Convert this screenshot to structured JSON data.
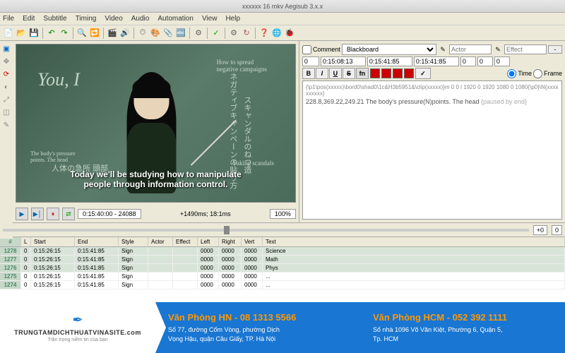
{
  "titlebar": "xxxxxx 16 mkv   Aegisub 3.x.x",
  "menu": {
    "file": "File",
    "edit": "Edit",
    "subtitle": "Subtitle",
    "timing": "Timing",
    "video": "Video",
    "audio": "Audio",
    "automation": "Automation",
    "view": "View",
    "help": "Help"
  },
  "video": {
    "chalk_you_i": "You, I",
    "chalk_spread": "How to spread\nnegative campaigns",
    "chalk_faking": "Faking scandals",
    "chalk_pressure": "The body's pressure\npoints. The head",
    "jp1": "ネガティブキャンペーンの貼り方",
    "jp2": "スキャンダルのねつ造",
    "jp3": "人体の急所  頭部",
    "subtitle_text": "Today we'll be studying how to manipulate\npeople through information control.",
    "time_display": "0:15:40:00 - 24088",
    "frame_info": "+1490ms; 18:1ms",
    "zoom": "100%"
  },
  "edit": {
    "comment_label": "Comment",
    "style_select": "Blackboard",
    "actor_ph": "Actor",
    "effect_ph": "Effect",
    "layer": "0",
    "start_time": "0:15:08:13",
    "end_time": "0:15:41:85",
    "duration": "0:15:41:85",
    "margin_l": "0",
    "margin_r": "0",
    "margin_v": "0",
    "radio_time": "Time",
    "radio_frame": "Frame",
    "tags": "{\\p1\\pos(xxxxx)\\bord0\\shad0\\1c&H3b5951&\\clip(xxxxx)}m 0 0 l 1920 0 1920 1080 0 1080{\\p0}\\N{xxxxxxxxxx}",
    "line_prefix": "228.8,369.22,249.21",
    "line_text": "The body's pressure(N)points. The head",
    "line_suffix": "{paused by end}"
  },
  "audio": {
    "pos": "+0",
    "dur": "0"
  },
  "grid": {
    "headers": {
      "num": "#",
      "L": "L",
      "start": "Start",
      "end": "End",
      "style": "Style",
      "actor": "Actor",
      "effect": "Effect",
      "left": "Left",
      "right": "Right",
      "vert": "Vert",
      "text": "Text"
    },
    "rows": [
      {
        "num": "1278",
        "L": "0",
        "start": "0:15:26:15",
        "end": "0:15:41:85",
        "style": "Sign",
        "actor": "",
        "effect": "",
        "left": "0000",
        "right": "0000",
        "vert": "0000",
        "text": "Science"
      },
      {
        "num": "1277",
        "L": "0",
        "start": "0:15:26:15",
        "end": "0:15:41:85",
        "style": "Sign",
        "actor": "",
        "effect": "",
        "left": "0000",
        "right": "0000",
        "vert": "0000",
        "text": "Math"
      },
      {
        "num": "1276",
        "L": "0",
        "start": "0:15:26:15",
        "end": "0:15:41:85",
        "style": "Sign",
        "actor": "",
        "effect": "",
        "left": "0000",
        "right": "0000",
        "vert": "0000",
        "text": "Phys"
      },
      {
        "num": "1275",
        "L": "0",
        "start": "0:15:26:15",
        "end": "0:15:41:85",
        "style": "Sign",
        "actor": "",
        "effect": "",
        "left": "0000",
        "right": "0000",
        "vert": "0000",
        "text": "..."
      },
      {
        "num": "1274",
        "L": "0",
        "start": "0:15:26:15",
        "end": "0:15:41:85",
        "style": "Sign",
        "actor": "",
        "effect": "",
        "left": "0000",
        "right": "0000",
        "vert": "0000",
        "text": "..."
      }
    ]
  },
  "banner": {
    "logo_text": "TRUNGTAMDICHTHUATVINASITE.com",
    "logo_sub": "Trân trọng niềm tin của bạn",
    "hn_title": "Văn Phòng HN - 08 1313 5566",
    "hn_addr": "Số 77, đường Cốm Vòng, phường Dịch\nVọng Hậu, quận Cầu Giấy, TP. Hà Nội",
    "hcm_title": "Văn Phòng HCM - 052 392 1111",
    "hcm_addr": "Số nhà 1096 Võ Văn Kiệt, Phường 6, Quận 5,\nTp. HCM"
  }
}
